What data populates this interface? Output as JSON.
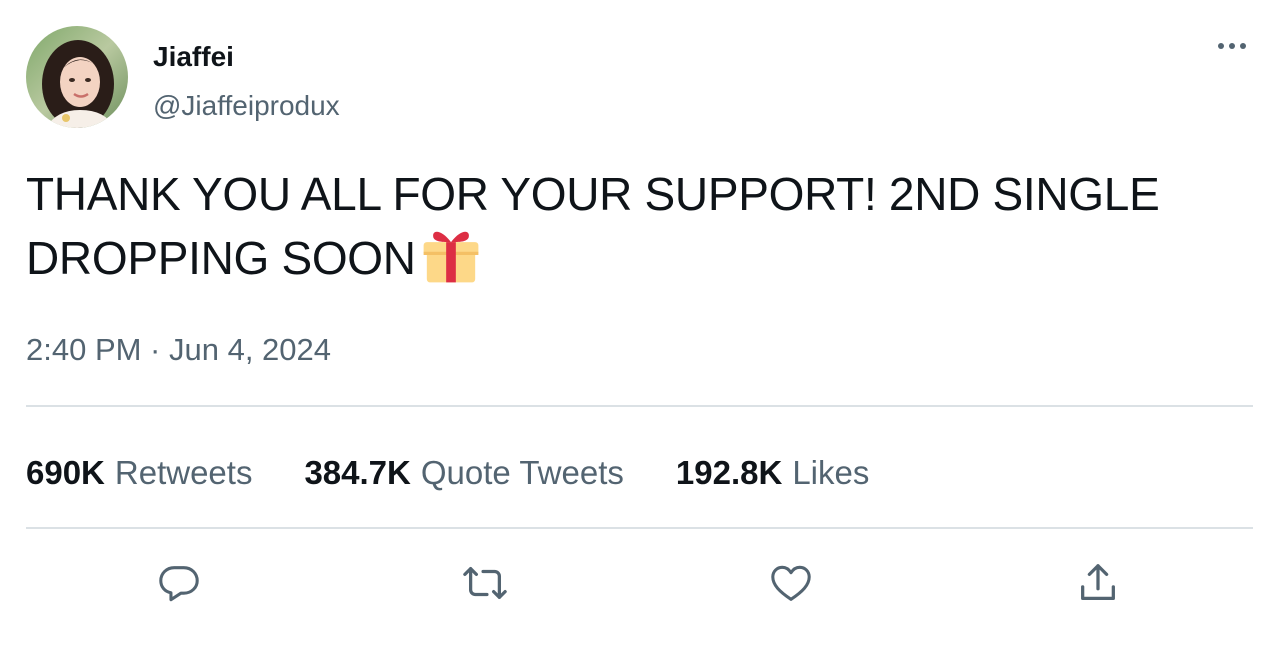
{
  "author": {
    "display_name": "Jiaffei",
    "handle": "@Jiaffeiprodux"
  },
  "tweet": {
    "text_line1": "THANK YOU ALL FOR YOUR SUPPORT! 2ND SINGLE",
    "text_line2": "DROPPING SOON",
    "emoji": "gift-emoji",
    "timestamp": "2:40 PM · Jun 4, 2024"
  },
  "stats": {
    "retweets_count": "690K",
    "retweets_label": "Retweets",
    "quotes_count": "384.7K",
    "quotes_label": "Quote Tweets",
    "likes_count": "192.8K",
    "likes_label": "Likes"
  },
  "actions": {
    "icons": [
      "reply-icon",
      "retweet-icon",
      "like-icon",
      "share-icon"
    ]
  },
  "colors": {
    "text_primary": "#0f1419",
    "text_secondary": "#536471",
    "divider": "#dbe1e5",
    "gift_box": "#fdd888",
    "gift_ribbon": "#dd2e44"
  }
}
